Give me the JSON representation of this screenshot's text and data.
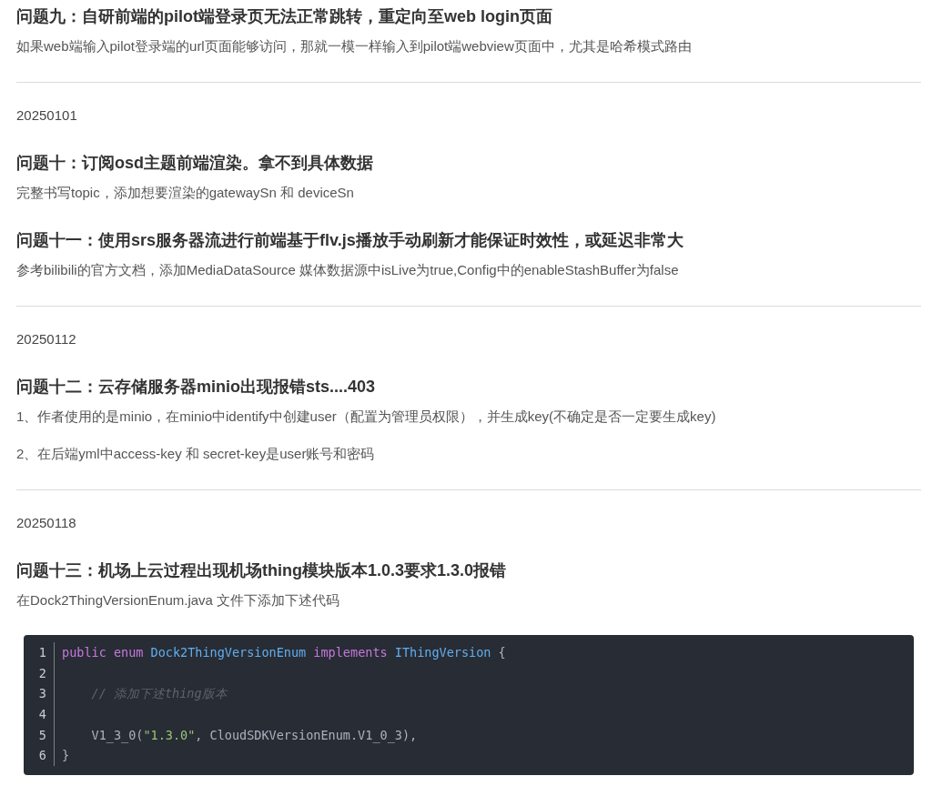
{
  "blocks": [
    {
      "kind": "heading",
      "text": "问题九：自研前端的pilot端登录页无法正常跳转，重定向至web login页面"
    },
    {
      "kind": "paragraph",
      "text": "如果web端输入pilot登录端的url页面能够访问，那就一模一样输入到pilot端webview页面中，尤其是哈希模式路由"
    },
    {
      "kind": "divider"
    },
    {
      "kind": "date",
      "text": "20250101"
    },
    {
      "kind": "heading",
      "text": "问题十：订阅osd主题前端渲染。拿不到具体数据"
    },
    {
      "kind": "paragraph",
      "text": "完整书写topic，添加想要渲染的gatewaySn 和 deviceSn"
    },
    {
      "kind": "heading",
      "text": "问题十一：使用srs服务器流进行前端基于flv.js播放手动刷新才能保证时效性，或延迟非常大"
    },
    {
      "kind": "paragraph",
      "text": "参考bilibili的官方文档，添加MediaDataSource 媒体数据源中isLive为true,Config中的enableStashBuffer为false"
    },
    {
      "kind": "divider"
    },
    {
      "kind": "date",
      "text": "20250112"
    },
    {
      "kind": "heading",
      "text": "问题十二：云存储服务器minio出现报错sts....403"
    },
    {
      "kind": "paragraph",
      "text": "1、作者使用的是minio，在minio中identify中创建user（配置为管理员权限），并生成key(不确定是否一定要生成key)"
    },
    {
      "kind": "paragraph",
      "text": "2、在后端yml中access-key 和 secret-key是user账号和密码"
    },
    {
      "kind": "divider"
    },
    {
      "kind": "date",
      "text": "20250118"
    },
    {
      "kind": "heading",
      "text": "问题十三：机场上云过程出现机场thing模块版本1.0.3要求1.3.0报错"
    },
    {
      "kind": "paragraph",
      "text": "在Dock2ThingVersionEnum.java 文件下添加下述代码"
    },
    {
      "kind": "code",
      "lines": [
        {
          "number": "1",
          "tokens": [
            {
              "kind": "keyword",
              "text": "public"
            },
            {
              "kind": "keyword",
              "text": " enum"
            },
            {
              "kind": "type",
              "text": " Dock2ThingVersionEnum"
            },
            {
              "kind": "keyword",
              "text": " implements"
            },
            {
              "kind": "type",
              "text": " IThingVersion"
            },
            {
              "kind": "plain",
              "text": " {"
            }
          ]
        },
        {
          "number": "2"
        },
        {
          "number": "3",
          "tokens": [
            {
              "kind": "comment",
              "text": "    // 添加下述thing版本"
            }
          ]
        },
        {
          "number": "4"
        },
        {
          "number": "5",
          "tokens": [
            {
              "kind": "plain",
              "text": "    V1_3_0("
            },
            {
              "kind": "string",
              "text": "\"1.3.0\""
            },
            {
              "kind": "plain",
              "text": ", CloudSDKVersionEnum.V1_0_3),"
            }
          ]
        },
        {
          "number": "6",
          "tokens": [
            {
              "kind": "plain",
              "text": "}"
            }
          ]
        }
      ]
    }
  ]
}
